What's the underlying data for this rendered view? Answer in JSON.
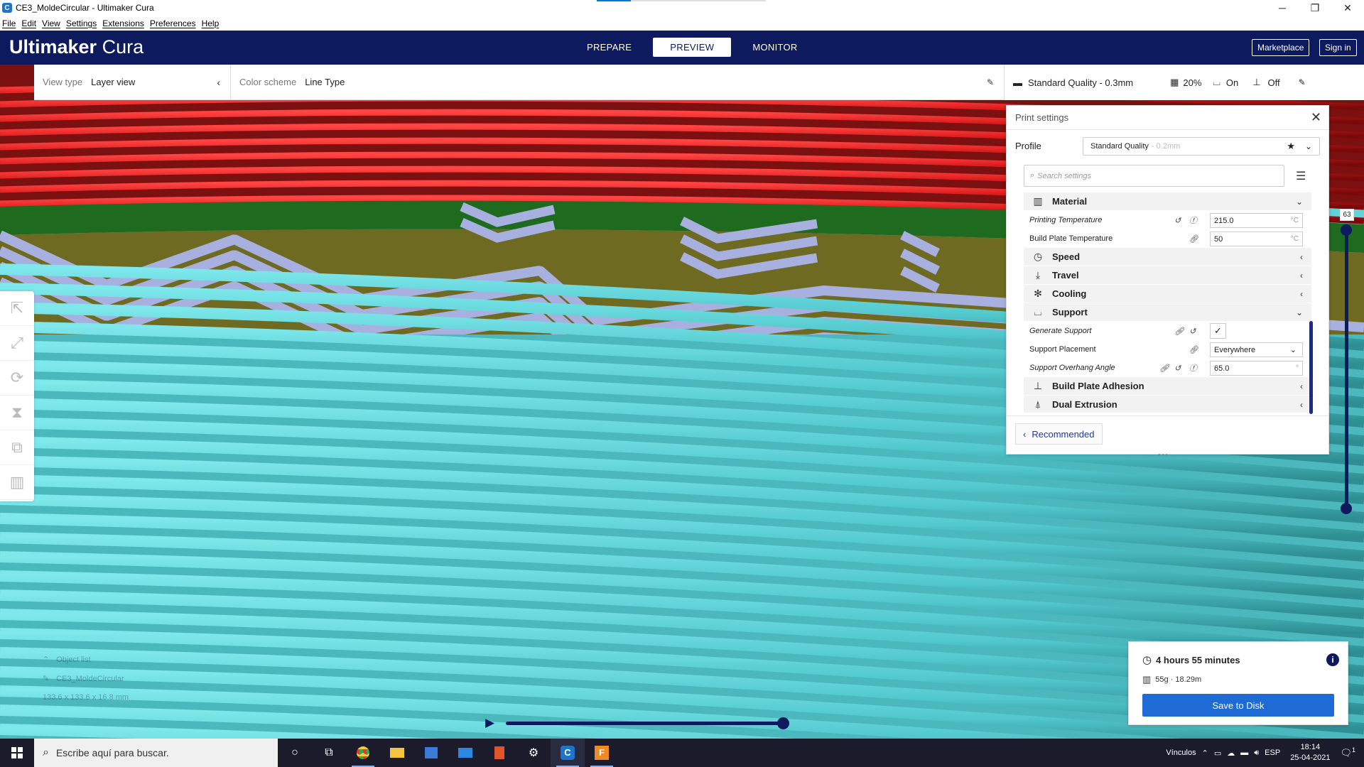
{
  "window": {
    "title": "CE3_MoldeCircular - Ultimaker Cura",
    "minimize": "─",
    "maximize": "❐",
    "close": "✕"
  },
  "menu": [
    "File",
    "Edit",
    "View",
    "Settings",
    "Extensions",
    "Preferences",
    "Help"
  ],
  "header": {
    "brand_main": "Ultimaker",
    "brand_sub": " Cura",
    "stages": [
      "PREPARE",
      "PREVIEW",
      "MONITOR"
    ],
    "active_stage": "PREVIEW",
    "marketplace": "Marketplace",
    "signin": "Sign in"
  },
  "viewbar": {
    "view_type_label": "View type",
    "view_type_value": "Layer view",
    "color_scheme_label": "Color scheme",
    "color_scheme_value": "Line Type"
  },
  "quality": {
    "profile": "Standard Quality - 0.3mm",
    "infill": "20%",
    "support": "On",
    "adhesion": "Off"
  },
  "panel": {
    "title": "Print settings",
    "profile_label": "Profile",
    "profile_value": "Standard Quality",
    "profile_dim": "- 0.2mm",
    "search_placeholder": "Search settings",
    "categories": {
      "material": "Material",
      "speed": "Speed",
      "travel": "Travel",
      "cooling": "Cooling",
      "support": "Support",
      "adhesion": "Build Plate Adhesion",
      "dual": "Dual Extrusion"
    },
    "settings": {
      "print_temp_label": "Printing Temperature",
      "print_temp_value": "215.0",
      "print_temp_unit": "°C",
      "bed_temp_label": "Build Plate Temperature",
      "bed_temp_value": "50",
      "bed_temp_unit": "°C",
      "gen_support_label": "Generate Support",
      "support_place_label": "Support Placement",
      "support_place_value": "Everywhere",
      "overhang_label": "Support Overhang Angle",
      "overhang_value": "65.0",
      "overhang_unit": "°"
    },
    "recommended": "Recommended"
  },
  "layer": {
    "current": "63"
  },
  "objects": {
    "list_label": "Object list",
    "object_name": "CE3_MoldeCircular",
    "dims": "133.6 x 133.6 x 16.8 mm"
  },
  "printinfo": {
    "time": "4 hours 55 minutes",
    "material": "55g · 18.29m",
    "save": "Save to Disk"
  },
  "taskbar": {
    "search": "Escribe aquí para buscar.",
    "links": "Vínculos",
    "lang": "ESP",
    "time": "18:14",
    "date": "25-04-2021",
    "notif": "1"
  },
  "colors": {
    "header_bg": "#0e1a5e",
    "accent": "#1e6bd6",
    "wall_outer": "#e23030",
    "wall_inner": "#5fd3d8",
    "support": "#9fa8d8",
    "skin": "#7a7a2a"
  }
}
